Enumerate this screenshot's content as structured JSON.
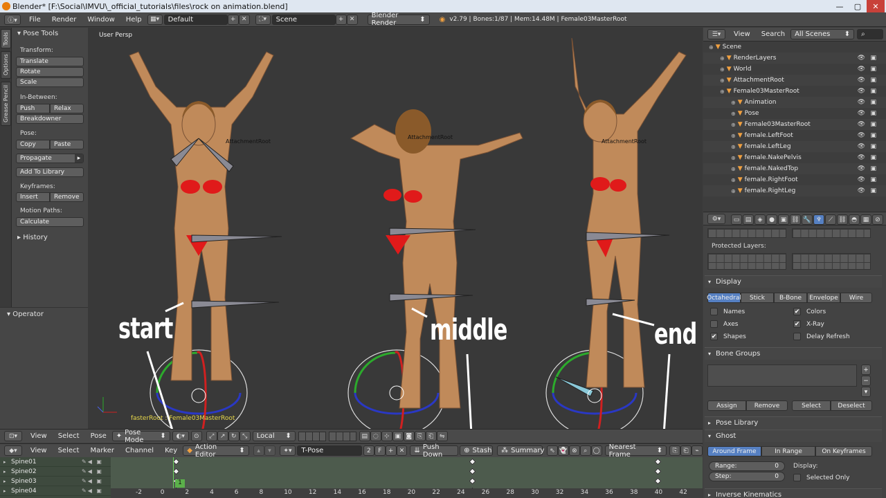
{
  "window": {
    "title": "Blender* [F:\\Social\\IMVU\\_official_tutorials\\files\\rock on animation.blend]",
    "minimize": "—",
    "maximize": "▢",
    "close": "✕"
  },
  "topbar": {
    "menus": [
      "File",
      "Render",
      "Window",
      "Help"
    ],
    "layout": "Default",
    "scene": "Scene",
    "engine": "Blender Render",
    "stats": "v2.79 | Bones:1/87 | Mem:14.48M | Female03MasterRoot"
  },
  "tabs": {
    "tools": "Tools",
    "options": "Options",
    "grease_pencil": "Grease Pencil"
  },
  "toolpanel": {
    "title": "Pose Tools",
    "transform_label": "Transform:",
    "translate": "Translate",
    "rotate": "Rotate",
    "scale": "Scale",
    "inbetween_label": "In-Between:",
    "push": "Push",
    "relax": "Relax",
    "breakdowner": "Breakdowner",
    "pose_label": "Pose:",
    "copy": "Copy",
    "paste": "Paste",
    "propagate": "Propagate",
    "add_to_library": "Add To Library",
    "keyframes_label": "Keyframes:",
    "insert": "Insert",
    "remove": "Remove",
    "motion_paths_label": "Motion Paths:",
    "calculate": "Calculate",
    "history": "History",
    "operator": "Operator"
  },
  "viewport": {
    "view_label": "User Persp",
    "object_label_left": "AttachmentRoot",
    "object_label_mid": "AttachmentRoot",
    "object_label_right": "AttachmentRoot",
    "bottom_label": "fasterRoot : Female03MasterRoot",
    "annotations": {
      "start": "start",
      "middle": "middle",
      "end": "end"
    }
  },
  "viewport_header": {
    "view": "View",
    "select": "Select",
    "pose": "Pose",
    "mode": "Pose Mode",
    "orientation": "Local"
  },
  "dopesheet_header": {
    "view": "View",
    "select": "Select",
    "marker": "Marker",
    "channel": "Channel",
    "key": "Key",
    "editor": "Action Editor",
    "action": "T-Pose",
    "users": "2",
    "fake_user": "F",
    "push_down": "Push Down",
    "stash": "Stash",
    "summary": "Summary",
    "snap": "Nearest Frame"
  },
  "dopesheet": {
    "channels": [
      "Spine01",
      "Spine02",
      "Spine03",
      "Spine04"
    ],
    "ruler": [
      "-2",
      "0",
      "2",
      "4",
      "6",
      "8",
      "10",
      "12",
      "14",
      "16",
      "18",
      "20",
      "22",
      "24",
      "26",
      "28",
      "30",
      "32",
      "34",
      "36",
      "38",
      "40",
      "42"
    ],
    "current_frame": "1",
    "keyframes": [
      1,
      25,
      40
    ]
  },
  "outliner_header": {
    "view": "View",
    "search": "Search",
    "filter": "All Scenes"
  },
  "outliner": {
    "rows": [
      {
        "label": "Scene",
        "indent": 0
      },
      {
        "label": "RenderLayers",
        "indent": 1
      },
      {
        "label": "World",
        "indent": 1
      },
      {
        "label": "AttachmentRoot",
        "indent": 1
      },
      {
        "label": "Female03MasterRoot",
        "indent": 1
      },
      {
        "label": "Animation",
        "indent": 2
      },
      {
        "label": "Pose",
        "indent": 2
      },
      {
        "label": "Female03MasterRoot",
        "indent": 2
      },
      {
        "label": "female.LeftFoot",
        "indent": 2
      },
      {
        "label": "female.LeftLeg",
        "indent": 2
      },
      {
        "label": "female.NakePelvis",
        "indent": 2
      },
      {
        "label": "female.NakedTop",
        "indent": 2
      },
      {
        "label": "female.RightFoot",
        "indent": 2
      },
      {
        "label": "female.RightLeg",
        "indent": 2
      }
    ]
  },
  "properties": {
    "protected_layers": "Protected Layers:",
    "display": "Display",
    "display_modes": [
      "Octahedral",
      "Stick",
      "B-Bone",
      "Envelope",
      "Wire"
    ],
    "names": "Names",
    "axes": "Axes",
    "shapes": "Shapes",
    "colors": "Colors",
    "xray": "X-Ray",
    "delay_refresh": "Delay Refresh",
    "bone_groups": "Bone Groups",
    "assign": "Assign",
    "remove": "Remove",
    "select": "Select",
    "deselect": "Deselect",
    "pose_library": "Pose Library",
    "ghost": "Ghost",
    "ghost_modes": [
      "Around Frame",
      "In Range",
      "On Keyframes"
    ],
    "range_label": "Range:",
    "range_value": "0",
    "step_label": "Step:",
    "step_value": "0",
    "display_label": "Display:",
    "selected_only": "Selected Only",
    "inverse_kinematics": "Inverse Kinematics"
  },
  "colors": {
    "accent": "#5680c2",
    "keyframe": "#f0f0f0",
    "playhead": "#5bb04a",
    "armature_orange": "#f0a040"
  }
}
